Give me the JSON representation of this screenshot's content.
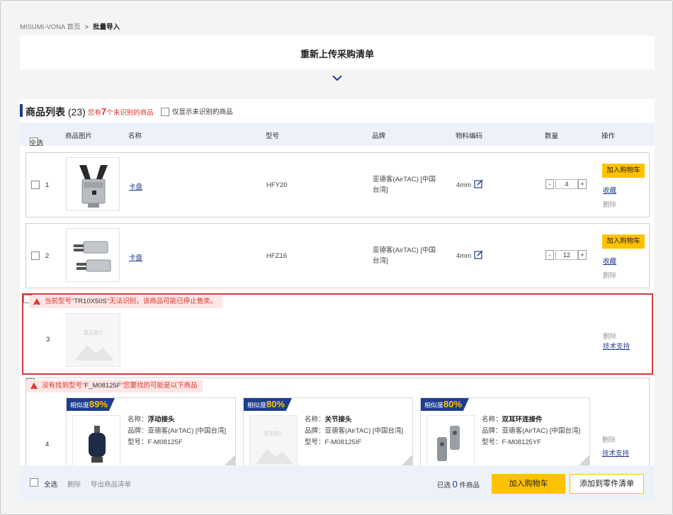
{
  "breadcrumb": {
    "home": "MISUMI-VONA 首页",
    "sep": ">",
    "current": "批量导入"
  },
  "upload": {
    "title": "重新上传采购清单"
  },
  "list": {
    "title": "商品列表",
    "count": "(23)",
    "unrec_pre": "您有",
    "unrec_num": "7",
    "unrec_post": "个未识别的商品",
    "only_unrec": "仅显示未识别的商品"
  },
  "columns": {
    "select_all": "全选",
    "image": "商品图片",
    "name": "名称",
    "model": "型号",
    "brand": "品牌",
    "material_code": "物料编码",
    "qty": "数量",
    "action": "操作"
  },
  "rows": [
    {
      "num": "1",
      "name": "卡盘",
      "model": "HFY20",
      "brand": "亚德客(AirTAC) [中国台湾]",
      "code": "4mm",
      "qty": "4",
      "cart": "加入购物车",
      "fav": "收藏",
      "del": "删除"
    },
    {
      "num": "2",
      "name": "卡盘",
      "model": "HFZ16",
      "brand": "亚德客(AirTAC) [中国台湾]",
      "code": "4mm",
      "qty": "12",
      "cart": "加入购物车",
      "fav": "收藏",
      "del": "删除"
    }
  ],
  "error_row": {
    "num": "3",
    "msg_pre": "当前型号\"",
    "model": "TR10X50S",
    "msg_post": "\"无法识别，该商品可能已停止售卖。",
    "no_image": "暂无图片",
    "del": "删除",
    "support": "技术支持"
  },
  "suggest_row": {
    "num": "4",
    "msg_pre": "没有找到型号\"",
    "model": "F_M08125F",
    "msg_post": "\"您要找的可能是以下商品",
    "del": "删除",
    "support": "技术支持",
    "labels": {
      "sim": "相似度",
      "name": "名称：",
      "brand": "品牌：",
      "model": "型号："
    },
    "cards": [
      {
        "sim": "89%",
        "name": "浮动接头",
        "brand": "亚德客(AirTAC) [中国台湾]",
        "model": "F-M08125F",
        "image": "floating-joint"
      },
      {
        "sim": "80%",
        "name": "关节接头",
        "brand": "亚德客(AirTAC) [中国台湾]",
        "model": "F-M08125IF",
        "image": "none",
        "no_image": "暂无图片"
      },
      {
        "sim": "80%",
        "name": "双耳环连接件",
        "brand": "亚德客(AirTAC) [中国台湾]",
        "model": "F-M08125YF",
        "image": "clevis"
      }
    ]
  },
  "footer": {
    "select_all": "全选",
    "delete": "删除",
    "export": "导出商品清单",
    "selected_pre": "已选",
    "selected_count": "0",
    "selected_post": "件商品",
    "add_cart": "加入购物车",
    "add_parts": "添加到零件清单"
  },
  "colors": {
    "accent": "#1f3d8c",
    "yellow": "#ffc200",
    "error": "#e0332c"
  }
}
